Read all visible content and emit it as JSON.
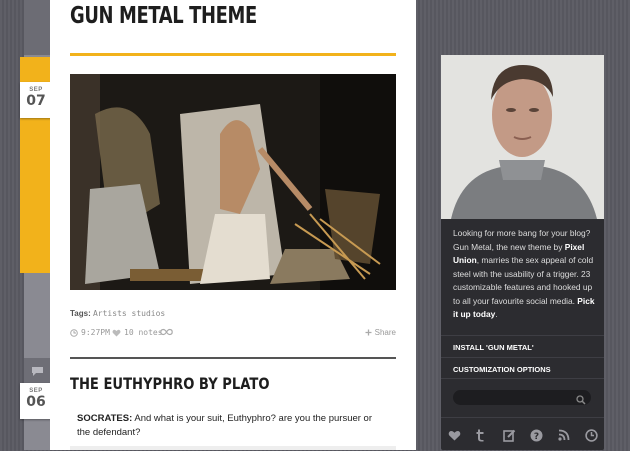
{
  "blog": {
    "title": "GUN METAL THEME"
  },
  "posts": [
    {
      "type": "photo",
      "date": {
        "month": "SEP",
        "day": "07"
      },
      "tags_label": "Tags:",
      "tags": "Artists studios",
      "time": "9:27PM",
      "notes": "10 notes",
      "share_label": "Share"
    },
    {
      "type": "text",
      "date": {
        "month": "SEP",
        "day": "06"
      },
      "title": "THE EUTHYPHRO BY PLATO",
      "speaker": "SOCRATES:",
      "body": "And what is your suit, Euthyphro? are you the pursuer or the defendant?"
    }
  ],
  "sidebar": {
    "about_1": "Looking for more bang for your blog? Gun Metal, the new theme by ",
    "about_brand": "Pixel Union",
    "about_2": ", marries the sex appeal of cold steel with the usability of a trigger. 23 customizable features and hooked up to all your favourite social media. ",
    "about_cta": "Pick it up today",
    "about_end": ".",
    "links": [
      "INSTALL 'GUN METAL'",
      "CUSTOMIZATION OPTIONS"
    ],
    "search_placeholder": "",
    "social_icons": [
      "heart-icon",
      "tumblr-icon",
      "edit-icon",
      "question-icon",
      "rss-icon",
      "clock-icon"
    ]
  },
  "colors": {
    "accent": "#f2b21b",
    "sidebar_bg": "#2c2c30",
    "page_bg": "#5a5a62"
  }
}
